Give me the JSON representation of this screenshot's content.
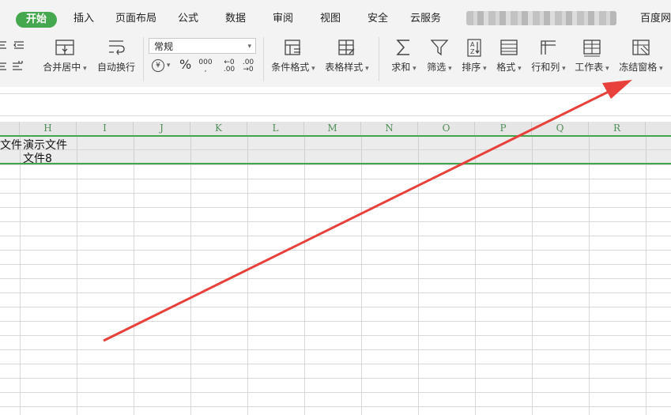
{
  "tabs": [
    "开始",
    "插入",
    "页面布局",
    "公式",
    "数据",
    "审阅",
    "视图",
    "安全",
    "云服务",
    "百度网盘"
  ],
  "ribbon": {
    "merge": "合并居中",
    "wrap": "自动换行",
    "number_format": "常规",
    "currency": "¥",
    "percent": "%",
    "thousands": "000",
    "inc_dec": "←0 .00",
    "dec_dec": ".00 →0",
    "conditional": "条件格式",
    "table_style": "表格样式",
    "sum": "求和",
    "filter": "筛选",
    "sort": "排序",
    "format": "格式",
    "rowcol": "行和列",
    "sheet": "工作表",
    "freeze": "冻结窗格"
  },
  "columns": [
    "H",
    "I",
    "J",
    "K",
    "L",
    "M",
    "N",
    "O",
    "P",
    "Q",
    "R"
  ],
  "cells": {
    "g1": "文件",
    "h1_line1": "演示文件",
    "h1_line2": "文件8"
  },
  "colors": {
    "accent": "#45a84f",
    "arrow": "#e8403a"
  }
}
